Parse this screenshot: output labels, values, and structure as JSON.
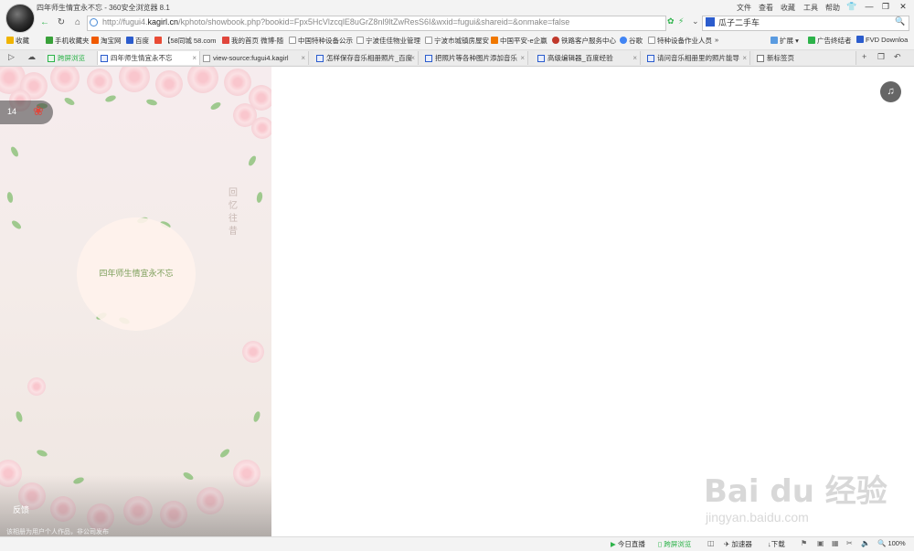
{
  "window": {
    "title": "四年师生情宜永不忘 - 360安全浏览器 8.1",
    "menu": [
      "文件",
      "查看",
      "收藏",
      "工具",
      "帮助"
    ],
    "controls": {
      "skin": "👕",
      "minimize": "—",
      "restore": "❐",
      "close": "✕"
    }
  },
  "nav": {
    "back": "←",
    "refresh": "↻",
    "home": "⌂",
    "url_prefix": "http://fugui4.",
    "url_domain": "kagirl.cn",
    "url_suffix": "/kphoto/showbook.php?bookid=Fpx5HcVlzcqlE8uGrZ8nl9ltZwResS6I&wxid=fugui&shareid=&onmake=false",
    "search_value": "瓜子二手车",
    "search_icon": "🔍"
  },
  "bookmarks": [
    {
      "label": "收藏",
      "color": "#f0b400"
    },
    {
      "label": "手机收藏夹",
      "color": "#39a13a"
    },
    {
      "label": "淘宝网",
      "color": "#f05a00"
    },
    {
      "label": "百度",
      "color": "#2b5ccd"
    },
    {
      "label": "【58同城 58.com",
      "color": "#e94b35"
    },
    {
      "label": "我的首页 微博-随",
      "color": "#e0463c"
    },
    {
      "label": "中国特种设备公示",
      "color": "#999999"
    },
    {
      "label": "宁波佳佳物业管理",
      "color": "#999999"
    },
    {
      "label": "宁波市城镇房屋安",
      "color": "#999999"
    },
    {
      "label": "中国平安-e企赢",
      "color": "#f07800"
    },
    {
      "label": "铁路客户服务中心",
      "color": "#c0392b"
    },
    {
      "label": "谷歌",
      "color": "#4285f4"
    },
    {
      "label": "特种设备作业人员",
      "color": "#999999"
    },
    {
      "label": "»",
      "color": ""
    },
    {
      "label": "扩展",
      "color": "#5a9be0"
    },
    {
      "label": "广告终结者",
      "color": "#2db34a"
    },
    {
      "label": "FVD Downloa",
      "color": "#2b5ccd"
    }
  ],
  "tabs": [
    {
      "label": "跨屏浏览"
    },
    {
      "label": "四年师生情宜永不忘"
    },
    {
      "label": "view-source:fugui4.kagirl"
    },
    {
      "label": "怎样保存音乐相册照片_百度"
    },
    {
      "label": "把照片等各种图片添加音乐"
    },
    {
      "label": "高级编辑器_百度经验"
    },
    {
      "label": "请问音乐相册里的照片能导"
    },
    {
      "label": "新标签页"
    }
  ],
  "book": {
    "page_count": "14",
    "title": "四年师生情宜永不忘",
    "vertical_text": "回忆往昔",
    "author": "反馈",
    "footnote": "该相册为用户个人作品，非公司发布"
  },
  "watermark": {
    "main": "Bai du 经验",
    "sub": "jingyan.baidu.com"
  },
  "status": {
    "items": [
      "今日直播",
      "跨屏浏览",
      "加速器",
      "下载",
      "100%"
    ]
  }
}
